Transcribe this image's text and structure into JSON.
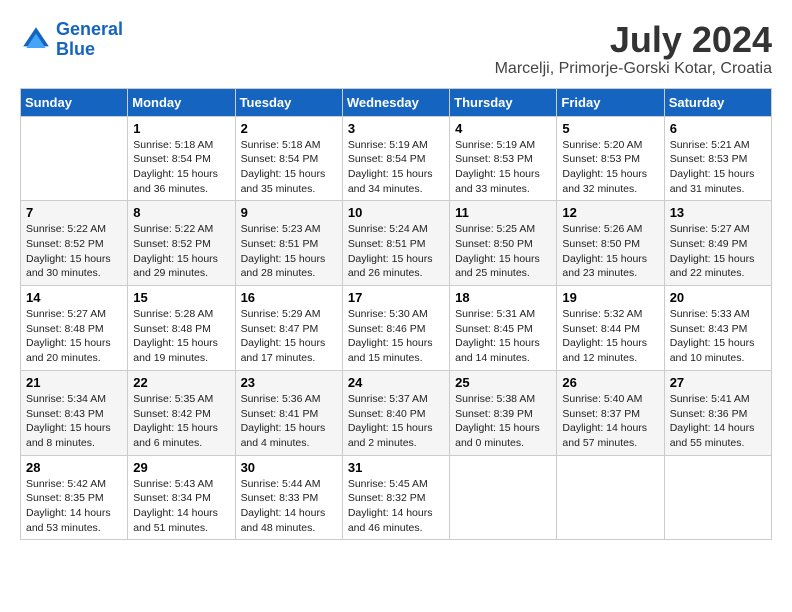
{
  "header": {
    "logo_line1": "General",
    "logo_line2": "Blue",
    "month": "July 2024",
    "location": "Marcelji, Primorje-Gorski Kotar, Croatia"
  },
  "weekdays": [
    "Sunday",
    "Monday",
    "Tuesday",
    "Wednesday",
    "Thursday",
    "Friday",
    "Saturday"
  ],
  "weeks": [
    [
      {
        "day": "",
        "sunrise": "",
        "sunset": "",
        "daylight": ""
      },
      {
        "day": "1",
        "sunrise": "Sunrise: 5:18 AM",
        "sunset": "Sunset: 8:54 PM",
        "daylight": "Daylight: 15 hours and 36 minutes."
      },
      {
        "day": "2",
        "sunrise": "Sunrise: 5:18 AM",
        "sunset": "Sunset: 8:54 PM",
        "daylight": "Daylight: 15 hours and 35 minutes."
      },
      {
        "day": "3",
        "sunrise": "Sunrise: 5:19 AM",
        "sunset": "Sunset: 8:54 PM",
        "daylight": "Daylight: 15 hours and 34 minutes."
      },
      {
        "day": "4",
        "sunrise": "Sunrise: 5:19 AM",
        "sunset": "Sunset: 8:53 PM",
        "daylight": "Daylight: 15 hours and 33 minutes."
      },
      {
        "day": "5",
        "sunrise": "Sunrise: 5:20 AM",
        "sunset": "Sunset: 8:53 PM",
        "daylight": "Daylight: 15 hours and 32 minutes."
      },
      {
        "day": "6",
        "sunrise": "Sunrise: 5:21 AM",
        "sunset": "Sunset: 8:53 PM",
        "daylight": "Daylight: 15 hours and 31 minutes."
      }
    ],
    [
      {
        "day": "7",
        "sunrise": "Sunrise: 5:22 AM",
        "sunset": "Sunset: 8:52 PM",
        "daylight": "Daylight: 15 hours and 30 minutes."
      },
      {
        "day": "8",
        "sunrise": "Sunrise: 5:22 AM",
        "sunset": "Sunset: 8:52 PM",
        "daylight": "Daylight: 15 hours and 29 minutes."
      },
      {
        "day": "9",
        "sunrise": "Sunrise: 5:23 AM",
        "sunset": "Sunset: 8:51 PM",
        "daylight": "Daylight: 15 hours and 28 minutes."
      },
      {
        "day": "10",
        "sunrise": "Sunrise: 5:24 AM",
        "sunset": "Sunset: 8:51 PM",
        "daylight": "Daylight: 15 hours and 26 minutes."
      },
      {
        "day": "11",
        "sunrise": "Sunrise: 5:25 AM",
        "sunset": "Sunset: 8:50 PM",
        "daylight": "Daylight: 15 hours and 25 minutes."
      },
      {
        "day": "12",
        "sunrise": "Sunrise: 5:26 AM",
        "sunset": "Sunset: 8:50 PM",
        "daylight": "Daylight: 15 hours and 23 minutes."
      },
      {
        "day": "13",
        "sunrise": "Sunrise: 5:27 AM",
        "sunset": "Sunset: 8:49 PM",
        "daylight": "Daylight: 15 hours and 22 minutes."
      }
    ],
    [
      {
        "day": "14",
        "sunrise": "Sunrise: 5:27 AM",
        "sunset": "Sunset: 8:48 PM",
        "daylight": "Daylight: 15 hours and 20 minutes."
      },
      {
        "day": "15",
        "sunrise": "Sunrise: 5:28 AM",
        "sunset": "Sunset: 8:48 PM",
        "daylight": "Daylight: 15 hours and 19 minutes."
      },
      {
        "day": "16",
        "sunrise": "Sunrise: 5:29 AM",
        "sunset": "Sunset: 8:47 PM",
        "daylight": "Daylight: 15 hours and 17 minutes."
      },
      {
        "day": "17",
        "sunrise": "Sunrise: 5:30 AM",
        "sunset": "Sunset: 8:46 PM",
        "daylight": "Daylight: 15 hours and 15 minutes."
      },
      {
        "day": "18",
        "sunrise": "Sunrise: 5:31 AM",
        "sunset": "Sunset: 8:45 PM",
        "daylight": "Daylight: 15 hours and 14 minutes."
      },
      {
        "day": "19",
        "sunrise": "Sunrise: 5:32 AM",
        "sunset": "Sunset: 8:44 PM",
        "daylight": "Daylight: 15 hours and 12 minutes."
      },
      {
        "day": "20",
        "sunrise": "Sunrise: 5:33 AM",
        "sunset": "Sunset: 8:43 PM",
        "daylight": "Daylight: 15 hours and 10 minutes."
      }
    ],
    [
      {
        "day": "21",
        "sunrise": "Sunrise: 5:34 AM",
        "sunset": "Sunset: 8:43 PM",
        "daylight": "Daylight: 15 hours and 8 minutes."
      },
      {
        "day": "22",
        "sunrise": "Sunrise: 5:35 AM",
        "sunset": "Sunset: 8:42 PM",
        "daylight": "Daylight: 15 hours and 6 minutes."
      },
      {
        "day": "23",
        "sunrise": "Sunrise: 5:36 AM",
        "sunset": "Sunset: 8:41 PM",
        "daylight": "Daylight: 15 hours and 4 minutes."
      },
      {
        "day": "24",
        "sunrise": "Sunrise: 5:37 AM",
        "sunset": "Sunset: 8:40 PM",
        "daylight": "Daylight: 15 hours and 2 minutes."
      },
      {
        "day": "25",
        "sunrise": "Sunrise: 5:38 AM",
        "sunset": "Sunset: 8:39 PM",
        "daylight": "Daylight: 15 hours and 0 minutes."
      },
      {
        "day": "26",
        "sunrise": "Sunrise: 5:40 AM",
        "sunset": "Sunset: 8:37 PM",
        "daylight": "Daylight: 14 hours and 57 minutes."
      },
      {
        "day": "27",
        "sunrise": "Sunrise: 5:41 AM",
        "sunset": "Sunset: 8:36 PM",
        "daylight": "Daylight: 14 hours and 55 minutes."
      }
    ],
    [
      {
        "day": "28",
        "sunrise": "Sunrise: 5:42 AM",
        "sunset": "Sunset: 8:35 PM",
        "daylight": "Daylight: 14 hours and 53 minutes."
      },
      {
        "day": "29",
        "sunrise": "Sunrise: 5:43 AM",
        "sunset": "Sunset: 8:34 PM",
        "daylight": "Daylight: 14 hours and 51 minutes."
      },
      {
        "day": "30",
        "sunrise": "Sunrise: 5:44 AM",
        "sunset": "Sunset: 8:33 PM",
        "daylight": "Daylight: 14 hours and 48 minutes."
      },
      {
        "day": "31",
        "sunrise": "Sunrise: 5:45 AM",
        "sunset": "Sunset: 8:32 PM",
        "daylight": "Daylight: 14 hours and 46 minutes."
      },
      {
        "day": "",
        "sunrise": "",
        "sunset": "",
        "daylight": ""
      },
      {
        "day": "",
        "sunrise": "",
        "sunset": "",
        "daylight": ""
      },
      {
        "day": "",
        "sunrise": "",
        "sunset": "",
        "daylight": ""
      }
    ]
  ]
}
